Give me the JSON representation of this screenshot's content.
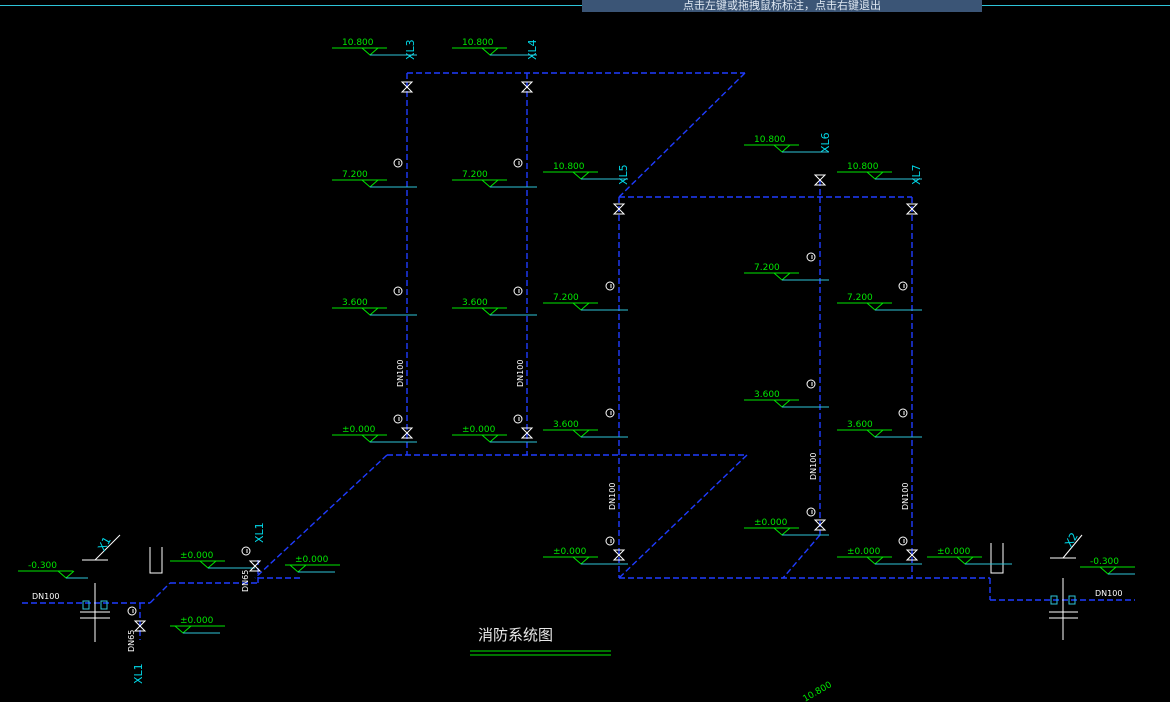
{
  "banner": "点击左键或拖拽鼠标标注，点击右键退出",
  "title": "消防系统图",
  "risers": [
    {
      "tag": "XL3",
      "elev_top": "10.800",
      "elev_mid": "7.200",
      "elev_low": "3.600",
      "elev_base": "±0.000",
      "pipe": "DN100"
    },
    {
      "tag": "XL4",
      "elev_top": "10.800",
      "elev_mid": "7.200",
      "elev_low": "3.600",
      "elev_base": "±0.000",
      "pipe": "DN100"
    },
    {
      "tag": "XL5",
      "elev_top": "10.800",
      "elev_mid": "7.200",
      "elev_low": "3.600",
      "elev_base": "±0.000",
      "pipe": "DN100"
    },
    {
      "tag": "XL6",
      "elev_top": "10.800",
      "elev_mid": "7.200",
      "elev_low": "3.600",
      "elev_base": "±0.000",
      "pipe": "DN100"
    },
    {
      "tag": "XL7",
      "elev_top": "10.800",
      "elev_mid": "7.200",
      "elev_low": "3.600",
      "elev_base": "±0.000",
      "pipe": "DN100"
    }
  ],
  "left_inlet": {
    "tag": "X1",
    "elev": "-0.300",
    "pipe": "DN100"
  },
  "right_inlet": {
    "tag": "X2",
    "elev": "-0.300",
    "pipe": "DN100"
  },
  "xl1": {
    "tag": "XL1",
    "pipe": "DN65",
    "elev_a": "±0.000",
    "elev_b": "±0.000",
    "elev_c": "±0.000"
  },
  "misc": {
    "right_base_elev": "±0.000",
    "partial_label": "10.800"
  },
  "colors": {
    "pipe": "#1f3cff",
    "level": "#00e600",
    "tag": "#00d8e8",
    "text": "#ffffff",
    "border": "#2ec4d8"
  }
}
